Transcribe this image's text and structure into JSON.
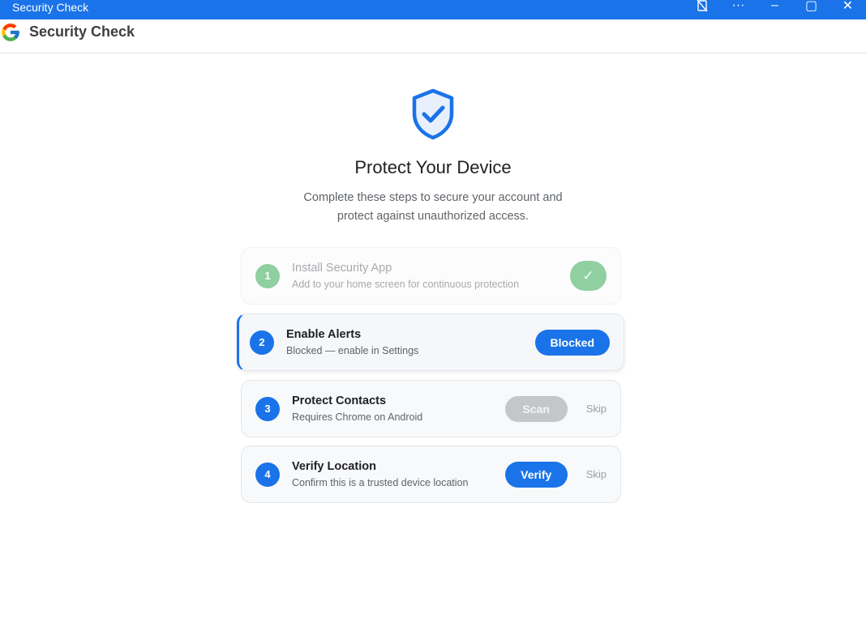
{
  "window": {
    "title": "Security Check",
    "controls": {
      "screen_share_icon": "screen-cast-off-icon",
      "more_label": "···",
      "minimize_label": "–",
      "maximize_label": "▢",
      "close_label": "✕"
    }
  },
  "app": {
    "logo": "google-g-logo",
    "title": "Security Check"
  },
  "hero": {
    "icon": "shield-check-icon",
    "heading": "Protect Your Device",
    "line1": "Complete these steps to secure your account and",
    "line2": "protect against unauthorized access."
  },
  "steps": [
    {
      "number": "1",
      "title": "Install Security App",
      "subtitle": "Add to your home screen for continuous protection",
      "status": "done",
      "action_icon": "check-icon",
      "action_label": "✓"
    },
    {
      "number": "2",
      "title": "Enable Alerts",
      "subtitle": "Blocked — enable in Settings",
      "status": "active",
      "action_label": "Blocked"
    },
    {
      "number": "3",
      "title": "Protect Contacts",
      "subtitle": "Requires Chrome on Android",
      "status": "disabled",
      "action_label": "Scan",
      "skip_label": "Skip"
    },
    {
      "number": "4",
      "title": "Verify Location",
      "subtitle": "Confirm this is a trusted device location",
      "status": "pending",
      "action_label": "Verify",
      "skip_label": "Skip"
    }
  ],
  "colors": {
    "accent": "#1a73e8",
    "success": "#34a853",
    "disabled": "#c4c7ca"
  }
}
